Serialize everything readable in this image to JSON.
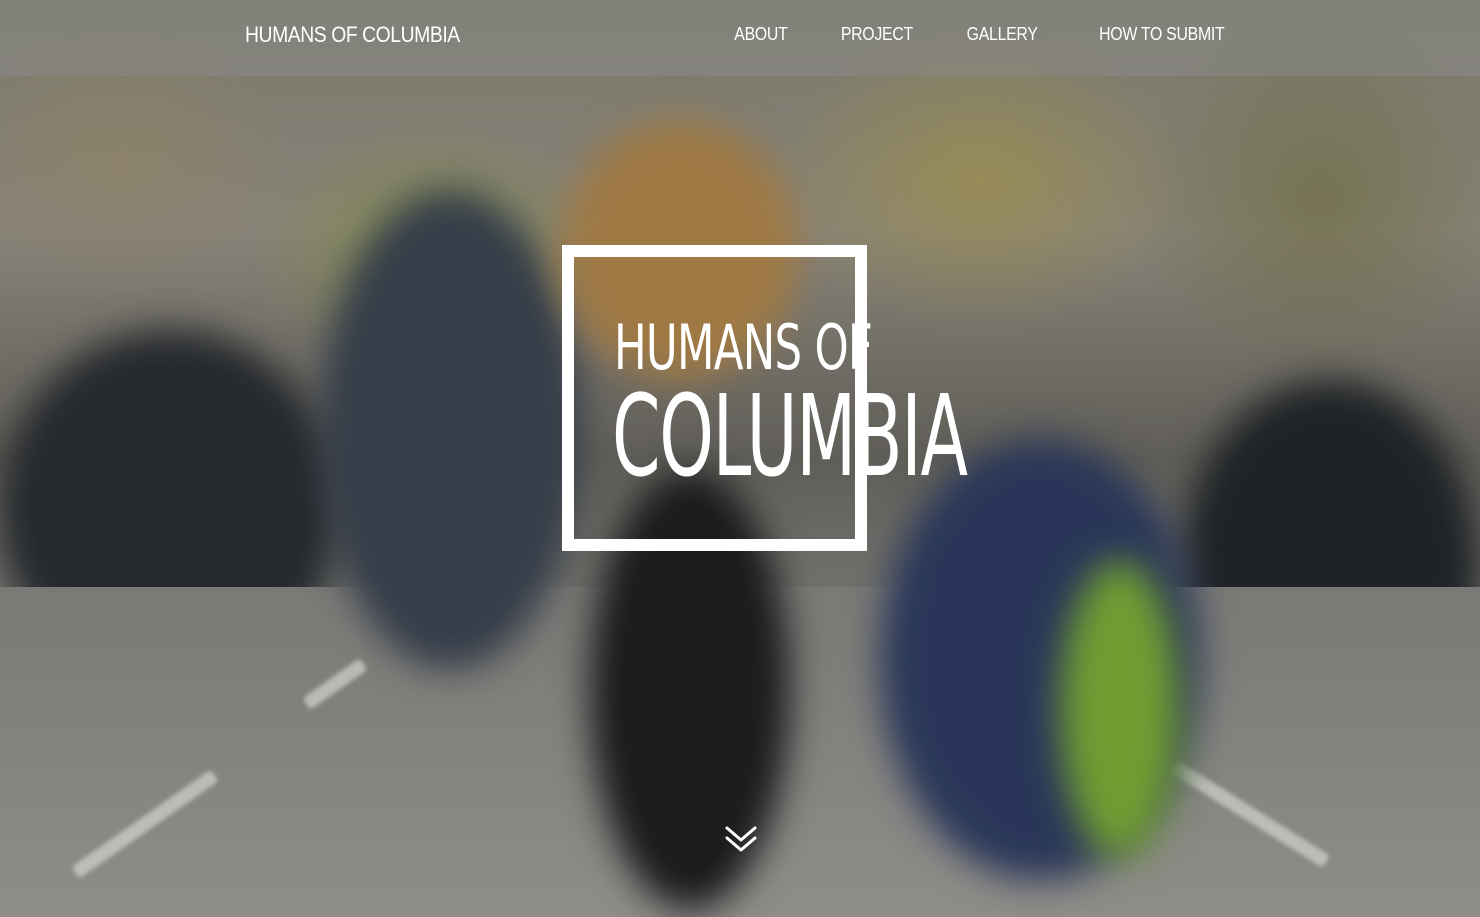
{
  "navbar": {
    "brand": "HUMANS OF COLUMBIA",
    "links": [
      {
        "label": "ABOUT"
      },
      {
        "label": "PROJECT"
      },
      {
        "label": "GALLERY"
      },
      {
        "label": "HOW TO SUBMIT"
      }
    ]
  },
  "hero": {
    "logo_line1": "HUMANS OF",
    "logo_line2": "COLUMBIA",
    "scroll_icon": "double-chevron-down-icon"
  },
  "colors": {
    "text": "#ffffff",
    "navbar_bg": "rgba(140,140,140,0.45)"
  }
}
